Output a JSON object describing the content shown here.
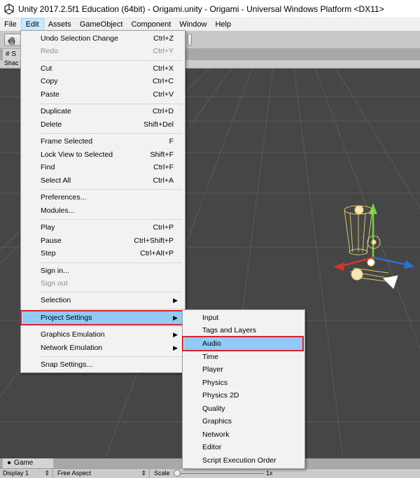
{
  "window": {
    "title": "Unity 2017.2.5f1 Education (64bit) - Origami.unity - Origami - Universal Windows Platform <DX11>"
  },
  "menubar": [
    "File",
    "Edit",
    "Assets",
    "GameObject",
    "Component",
    "Window",
    "Help"
  ],
  "scene": {
    "tab_label": "S",
    "shading_label": "Shac"
  },
  "edit_menu": {
    "items": [
      {
        "label": "Undo Selection Change",
        "shortcut": "Ctrl+Z"
      },
      {
        "label": "Redo",
        "shortcut": "Ctrl+Y",
        "disabled": true
      },
      {
        "label": "Cut",
        "shortcut": "Ctrl+X"
      },
      {
        "label": "Copy",
        "shortcut": "Ctrl+C"
      },
      {
        "label": "Paste",
        "shortcut": "Ctrl+V"
      },
      {
        "label": "Duplicate",
        "shortcut": "Ctrl+D"
      },
      {
        "label": "Delete",
        "shortcut": "Shift+Del"
      },
      {
        "label": "Frame Selected",
        "shortcut": "F"
      },
      {
        "label": "Lock View to Selected",
        "shortcut": "Shift+F"
      },
      {
        "label": "Find",
        "shortcut": "Ctrl+F"
      },
      {
        "label": "Select All",
        "shortcut": "Ctrl+A"
      },
      {
        "label": "Preferences...",
        "shortcut": ""
      },
      {
        "label": "Modules...",
        "shortcut": ""
      },
      {
        "label": "Play",
        "shortcut": "Ctrl+P"
      },
      {
        "label": "Pause",
        "shortcut": "Ctrl+Shift+P"
      },
      {
        "label": "Step",
        "shortcut": "Ctrl+Alt+P"
      },
      {
        "label": "Sign in...",
        "shortcut": ""
      },
      {
        "label": "Sign out",
        "shortcut": "",
        "disabled": true
      },
      {
        "label": "Selection",
        "shortcut": ""
      },
      {
        "label": "Project Settings",
        "shortcut": ""
      },
      {
        "label": "Graphics Emulation",
        "shortcut": ""
      },
      {
        "label": "Network Emulation",
        "shortcut": ""
      },
      {
        "label": "Snap Settings...",
        "shortcut": ""
      }
    ]
  },
  "project_settings_menu": {
    "items": [
      "Input",
      "Tags and Layers",
      "Audio",
      "Time",
      "Player",
      "Physics",
      "Physics 2D",
      "Quality",
      "Graphics",
      "Network",
      "Editor",
      "Script Execution Order"
    ]
  },
  "game": {
    "tab_label": "Game",
    "display": "Display 1",
    "aspect": "Free Aspect",
    "scale_label": "Scale",
    "scale_value": "1x"
  },
  "colors": {
    "highlight": "#91c9f7",
    "callout_border": "#d9232c",
    "scene_background": "#464646"
  }
}
